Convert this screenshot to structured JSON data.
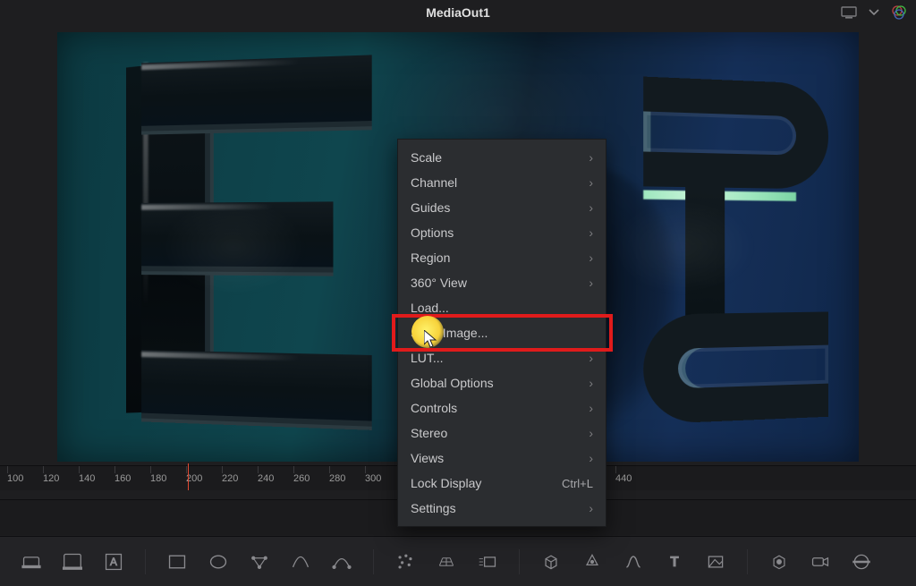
{
  "header": {
    "title": "MediaOut1"
  },
  "ruler": {
    "start": 100,
    "step": 20,
    "count": 18,
    "playhead": 208
  },
  "contextMenu": {
    "items": [
      {
        "label": "Scale",
        "submenu": true
      },
      {
        "label": "Channel",
        "submenu": true
      },
      {
        "label": "Guides",
        "submenu": true
      },
      {
        "label": "Options",
        "submenu": true
      },
      {
        "label": "Region",
        "submenu": true
      },
      {
        "label": "360° View",
        "submenu": true
      },
      {
        "label": "Load...",
        "submenu": false
      },
      {
        "label": "Save Image...",
        "submenu": false,
        "highlighted": true
      },
      {
        "label": "LUT...",
        "submenu": true
      },
      {
        "label": "Global Options",
        "submenu": true
      },
      {
        "label": "Controls",
        "submenu": true
      },
      {
        "label": "Stereo",
        "submenu": true
      },
      {
        "label": "Views",
        "submenu": true
      },
      {
        "label": "Lock Display",
        "submenu": false,
        "shortcut": "Ctrl+L"
      },
      {
        "label": "Settings",
        "submenu": true
      }
    ]
  },
  "icons": {
    "screen": "screen-icon",
    "chevron": "chevron-down-icon",
    "settings": "settings-rgb-icon"
  },
  "toolbar": {
    "tools": [
      "merge",
      "background",
      "text",
      "mask-rectangle",
      "mask-ellipse",
      "transform",
      "curve",
      "spline",
      "particles",
      "grid",
      "motion-blur",
      "3d-cube",
      "color-corrector",
      "color-curves",
      "text3d",
      "keyer",
      "node-3d",
      "camera",
      "output"
    ]
  }
}
